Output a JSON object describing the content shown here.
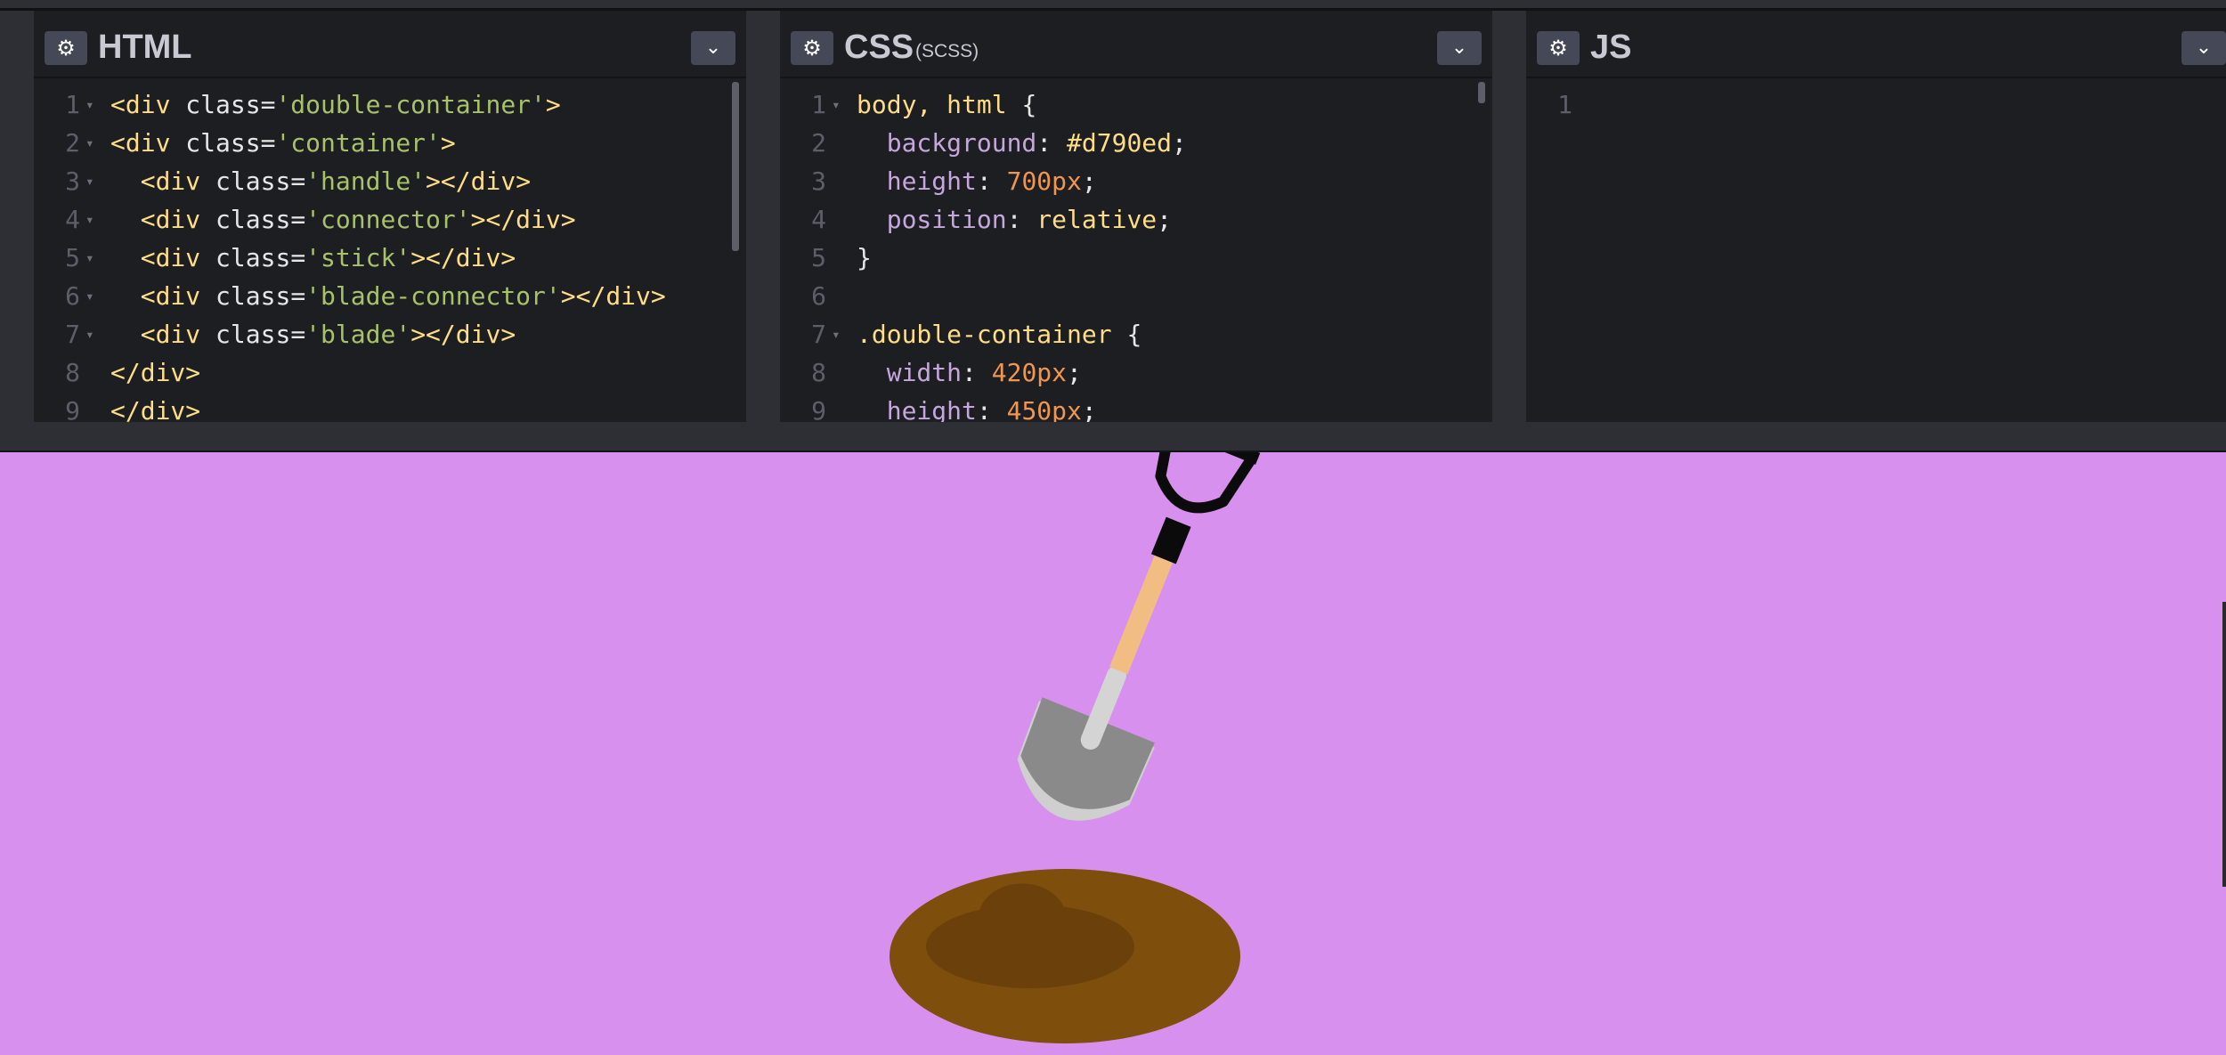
{
  "colors": {
    "preview_background": "#d790ed"
  },
  "panels": [
    {
      "id": "html",
      "title": "HTML",
      "subtitle": "",
      "settings_icon": "gear-icon",
      "collapse_icon": "chevron-down-icon"
    },
    {
      "id": "css",
      "title": "CSS",
      "subtitle": "(SCSS)",
      "settings_icon": "gear-icon",
      "collapse_icon": "chevron-down-icon"
    },
    {
      "id": "js",
      "title": "JS",
      "subtitle": "",
      "settings_icon": "gear-icon",
      "collapse_icon": "chevron-down-icon"
    }
  ],
  "html_code": [
    {
      "n": "1",
      "text": "<div class='double-container'>"
    },
    {
      "n": "2",
      "text": "<div class='container'>"
    },
    {
      "n": "3",
      "text": "  <div class='handle'></div>"
    },
    {
      "n": "4",
      "text": "  <div class='connector'></div>"
    },
    {
      "n": "5",
      "text": "  <div class='stick'></div>"
    },
    {
      "n": "6",
      "text": "  <div class='blade-connector'></div>"
    },
    {
      "n": "7",
      "text": "  <div class='blade'></div>"
    },
    {
      "n": "8",
      "text": "</div>"
    },
    {
      "n": "9",
      "text": "</div>"
    }
  ],
  "css_code": [
    {
      "n": "1",
      "text": "body, html {"
    },
    {
      "n": "2",
      "text": "  background: #d790ed;"
    },
    {
      "n": "3",
      "text": "  height: 700px;"
    },
    {
      "n": "4",
      "text": "  position: relative;"
    },
    {
      "n": "5",
      "text": "}"
    },
    {
      "n": "6",
      "text": ""
    },
    {
      "n": "7",
      "text": ".double-container {"
    },
    {
      "n": "8",
      "text": "  width: 420px;"
    },
    {
      "n": "9",
      "text": "  height: 450px;"
    }
  ],
  "js_code": [
    {
      "n": "1",
      "text": ""
    }
  ]
}
